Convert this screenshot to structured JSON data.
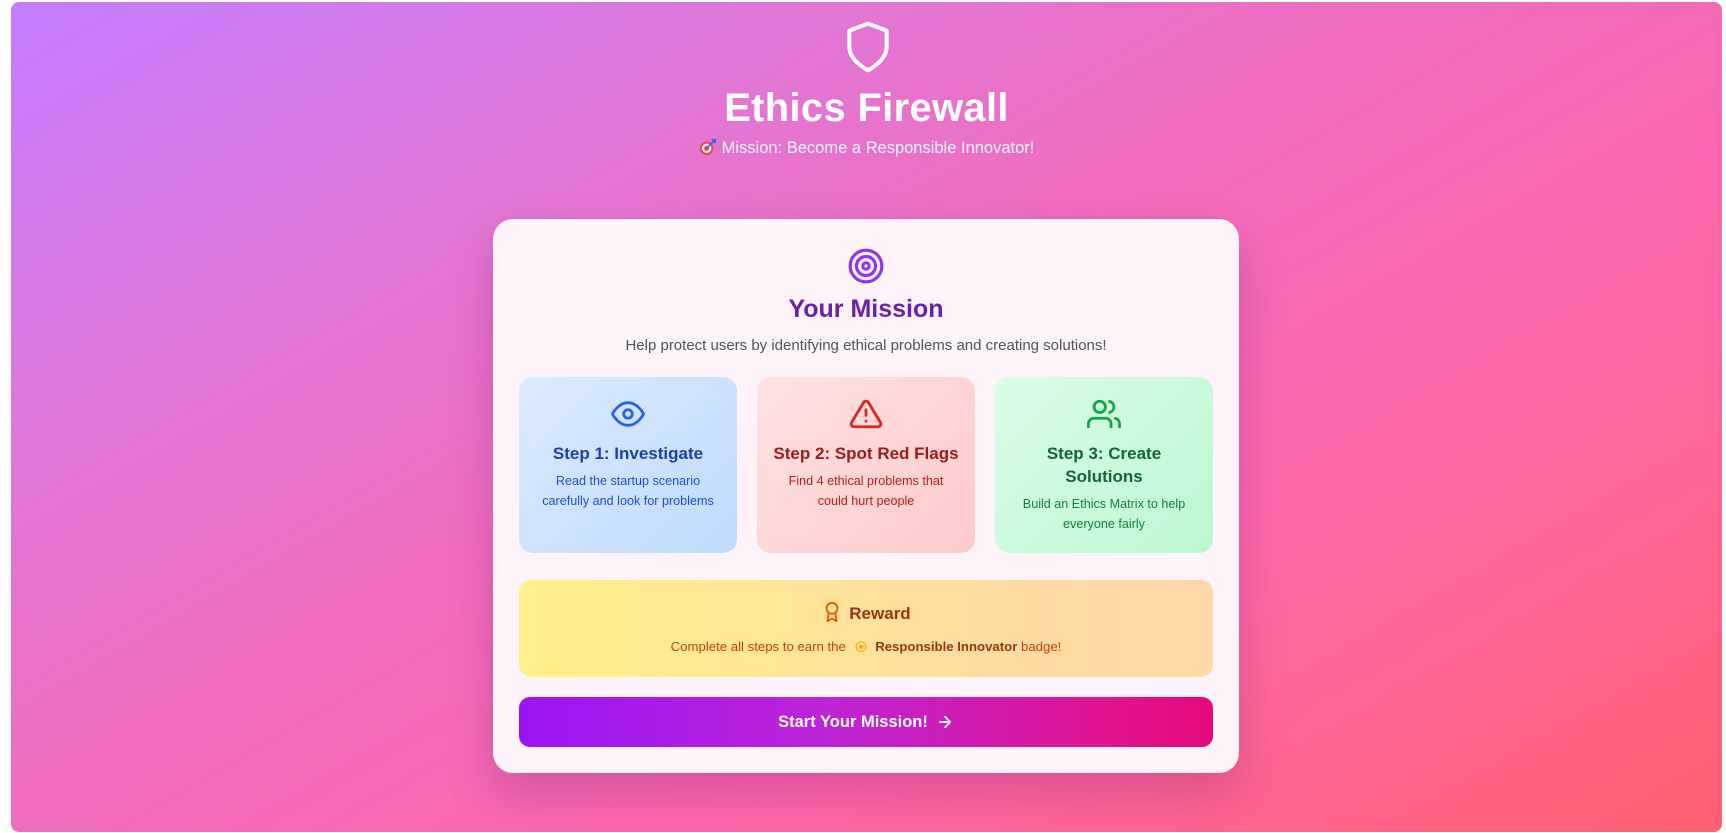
{
  "header": {
    "icon": "shield-icon",
    "title": "Ethics Firewall",
    "subtitle": "Mission: Become a Responsible Innovator!"
  },
  "mission_card": {
    "icon": "target-icon",
    "title": "Your Mission",
    "description": "Help protect users by identifying ethical problems and creating solutions!",
    "steps": [
      {
        "icon": "eye-icon",
        "title": "Step 1: Investigate",
        "text": "Read the startup scenario carefully and look for problems",
        "color": "#1e40af"
      },
      {
        "icon": "alert-triangle-icon",
        "title": "Step 2: Spot Red Flags",
        "text": "Find 4 ethical problems that could hurt people",
        "color": "#991b1b"
      },
      {
        "icon": "users-icon",
        "title": "Step 3: Create Solutions",
        "text": "Build an Ethics Matrix to help everyone fairly",
        "color": "#166534"
      }
    ],
    "reward": {
      "icon": "award-icon",
      "title": "Reward",
      "text_before": "Complete all steps to earn the",
      "badge_name": "Responsible Innovator",
      "text_after": "badge!"
    },
    "start_button": {
      "label": "Start Your Mission!",
      "icon": "arrow-right-icon"
    }
  },
  "colors": {
    "title_purple": "#6b21a8",
    "button_start": "#9a14f5",
    "button_end": "#e5087c"
  }
}
